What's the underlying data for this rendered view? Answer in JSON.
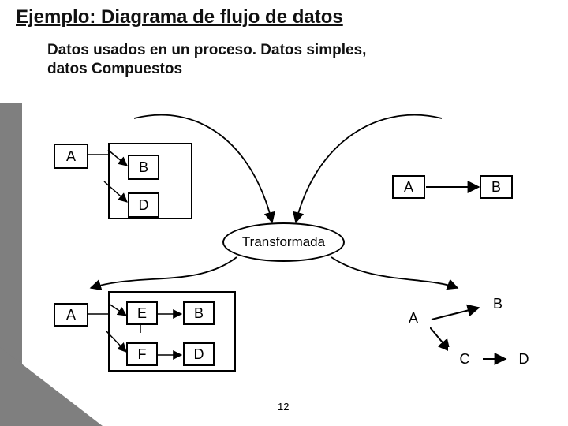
{
  "title": "Ejemplo: Diagrama de flujo de datos",
  "subtitle": "Datos usados en un proceso. Datos simples,\ndatos Compuestos",
  "ellipse": "Transformada",
  "labels": {
    "A": "A",
    "B": "B",
    "C": "C",
    "D": "D",
    "E": "E",
    "F": "F"
  },
  "page_number": "12"
}
